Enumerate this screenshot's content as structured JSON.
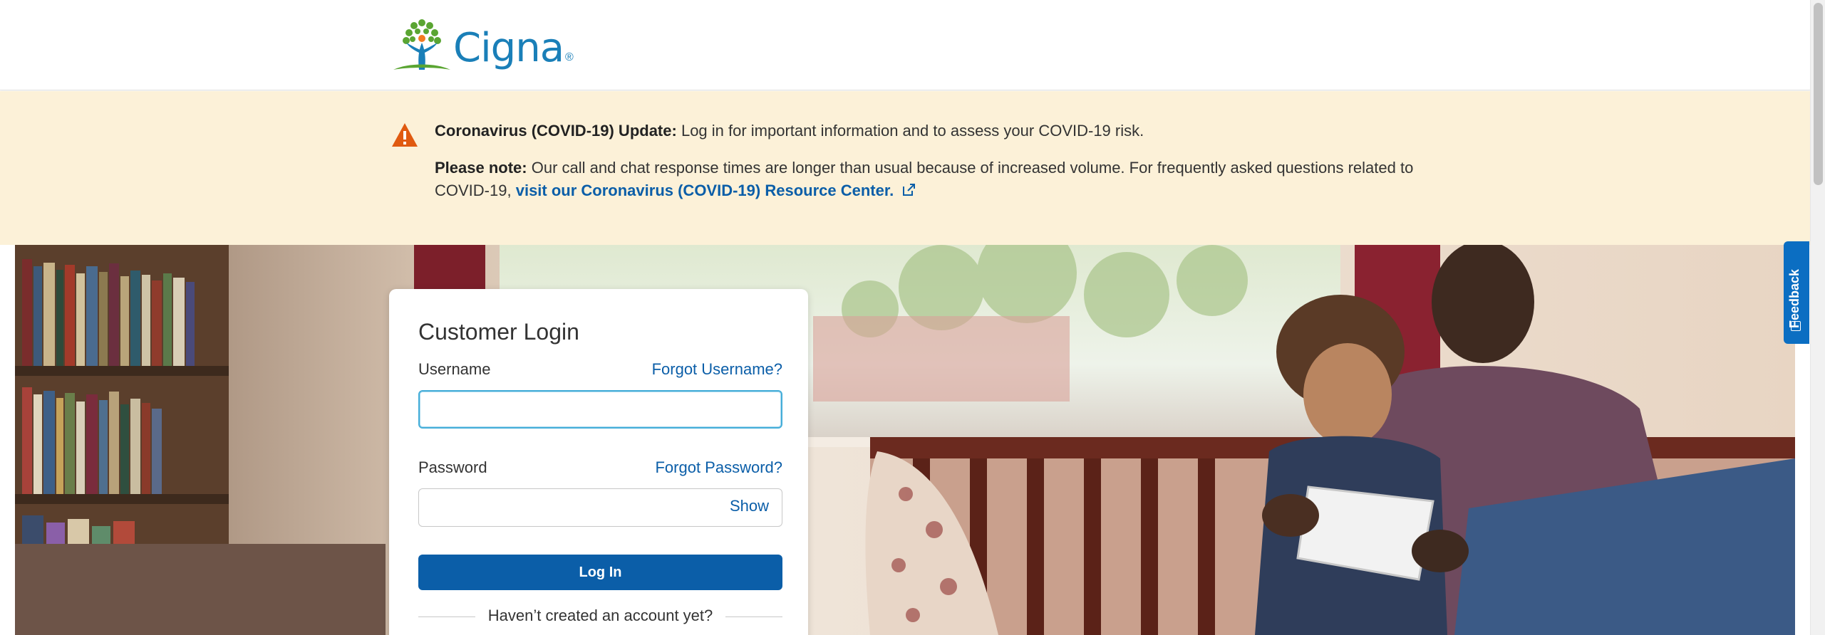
{
  "header": {
    "logo_text": "Cigna",
    "logo_mark": "®"
  },
  "alert": {
    "icon": "warning-triangle-icon",
    "covid_label": "Coronavirus (COVID-19) Update:",
    "covid_text": "Log in for important information and to assess your COVID-19 risk.",
    "note_label": "Please note:",
    "note_text": "Our call and chat response times are longer than usual because of increased volume. For frequently asked questions related to COVID-19,",
    "resource_link": "visit our Coronavirus (COVID-19) Resource Center."
  },
  "login": {
    "title": "Customer Login",
    "username_label": "Username",
    "forgot_username": "Forgot Username?",
    "username_value": "",
    "password_label": "Password",
    "forgot_password": "Forgot Password?",
    "password_value": "",
    "show_toggle": "Show",
    "login_button": "Log In",
    "no_account_text": "Haven’t created an account yet?"
  },
  "feedback": {
    "label": "Feedback"
  },
  "colors": {
    "brand_blue": "#0b5ea8",
    "alert_bg": "#fcf1d8",
    "warning_orange": "#e05a10"
  }
}
